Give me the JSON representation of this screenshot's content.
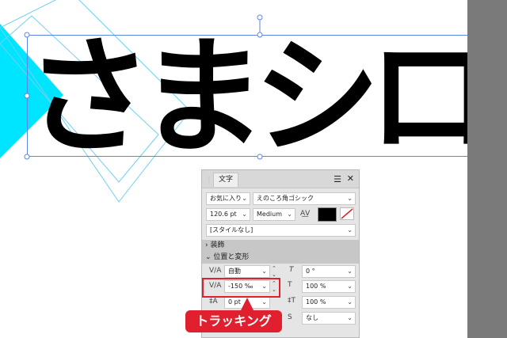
{
  "canvas": {
    "text": "さまシロ"
  },
  "panel": {
    "tab_label": "文字",
    "favorites": "お気に入り",
    "font_name": "えのころ角ゴシック",
    "font_size": "120.6 pt",
    "font_weight": "Medium",
    "style": "[スタイルなし]",
    "sections": {
      "decoration": "装飾",
      "position_transform": "位置と変形"
    },
    "kerning": "自動",
    "tracking": "-150 ‰",
    "baseline": "0 pt",
    "skew": "0 °",
    "h_scale": "100 %",
    "v_scale": "100 %",
    "case": "なし"
  },
  "callout": {
    "label": "トラッキング"
  },
  "colors": {
    "accent": "#e0202e",
    "cyan": "#00e5ff",
    "selection": "#5b86e5"
  }
}
